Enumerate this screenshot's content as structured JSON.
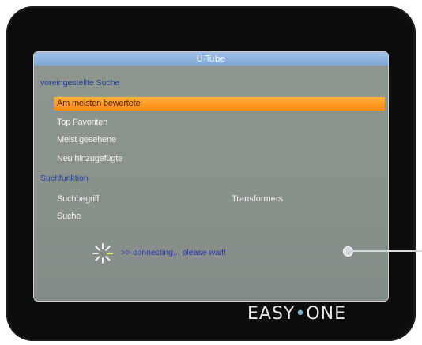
{
  "window": {
    "title": "U-Tube"
  },
  "sections": {
    "preset": "voreingestellte Suche",
    "search": "Suchfunktion"
  },
  "menu": [
    {
      "label": "Am meisten bewertete"
    },
    {
      "label": "Top Favoriten"
    },
    {
      "label": "Meist gesehene"
    },
    {
      "label": "Neu hinzugefügte"
    }
  ],
  "search": {
    "term_label": "Suchbegriff",
    "term_value": "Transformers",
    "search_label": "Suche"
  },
  "status": {
    "message": ">> connecting... please wait!"
  },
  "brand": {
    "left": "EASY",
    "dot": "•",
    "right": "ONE"
  },
  "colors": {
    "selection": "#ff9a22",
    "titlebar": "#8fb6df",
    "section_text": "#1f3f9e"
  },
  "icons": {
    "spinner": "loading-spinner-icon"
  }
}
